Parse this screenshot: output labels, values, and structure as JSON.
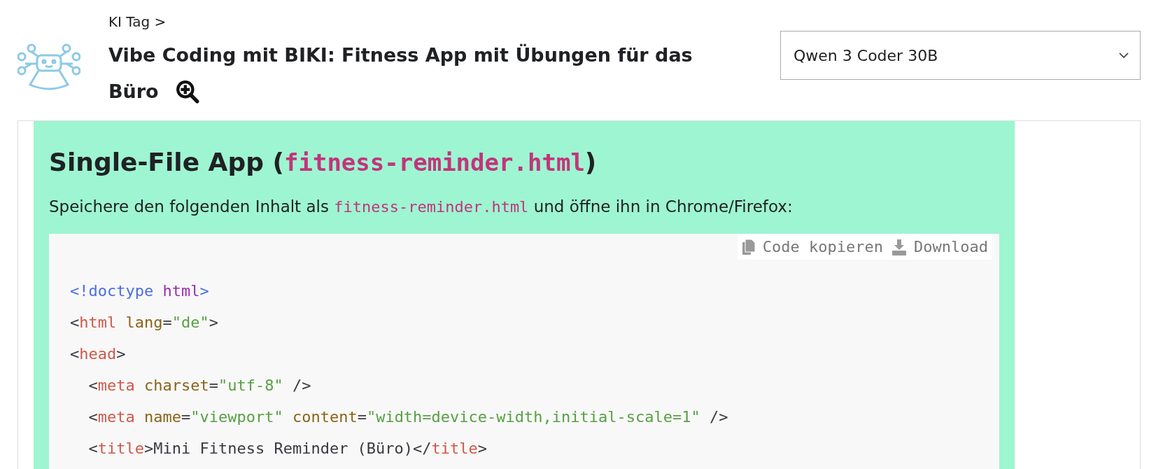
{
  "header": {
    "breadcrumb": "KI Tag >",
    "title_lines": [
      "Vibe Coding mit BIKI: Fitness App mit Übungen für das",
      "Büro"
    ],
    "model_select": {
      "value": "Qwen 3 Coder 30B"
    }
  },
  "content": {
    "heading": [
      {
        "kind": "text",
        "text": "Single-File App ("
      },
      {
        "kind": "code",
        "text": "fitness-reminder.html"
      },
      {
        "kind": "text",
        "text": ")"
      }
    ],
    "paragraph": [
      {
        "kind": "text",
        "text": "Speichere den folgenden Inhalt als "
      },
      {
        "kind": "code",
        "text": "fitness-reminder.html"
      },
      {
        "kind": "text",
        "text": " und öffne ihn in Chrome/Firefox:"
      }
    ],
    "code_block": {
      "actions": [
        {
          "kind": "copy",
          "label": "Code kopieren"
        },
        {
          "kind": "download",
          "label": "Download"
        }
      ],
      "lines": [
        [
          {
            "kind": "doctype",
            "text": "<!doctype "
          },
          {
            "kind": "keyword",
            "text": "html"
          },
          {
            "kind": "doctype",
            "text": ">"
          }
        ],
        [
          {
            "kind": "punct",
            "text": "<"
          },
          {
            "kind": "tag",
            "text": "html"
          },
          {
            "kind": "attr",
            "text": " lang"
          },
          {
            "kind": "punct",
            "text": "="
          },
          {
            "kind": "string",
            "text": "\"de\""
          },
          {
            "kind": "punct",
            "text": ">"
          }
        ],
        [
          {
            "kind": "punct",
            "text": "<"
          },
          {
            "kind": "tag",
            "text": "head"
          },
          {
            "kind": "punct",
            "text": ">"
          }
        ],
        [
          {
            "kind": "punct",
            "text": "  <"
          },
          {
            "kind": "tag",
            "text": "meta"
          },
          {
            "kind": "attr",
            "text": " charset"
          },
          {
            "kind": "punct",
            "text": "="
          },
          {
            "kind": "string",
            "text": "\"utf-8\""
          },
          {
            "kind": "punct",
            "text": " />"
          }
        ],
        [
          {
            "kind": "punct",
            "text": "  <"
          },
          {
            "kind": "tag",
            "text": "meta"
          },
          {
            "kind": "attr",
            "text": " name"
          },
          {
            "kind": "punct",
            "text": "="
          },
          {
            "kind": "string",
            "text": "\"viewport\""
          },
          {
            "kind": "attr",
            "text": " content"
          },
          {
            "kind": "punct",
            "text": "="
          },
          {
            "kind": "string",
            "text": "\"width=device-width,initial-scale=1\""
          },
          {
            "kind": "punct",
            "text": " />"
          }
        ],
        [
          {
            "kind": "punct",
            "text": "  <"
          },
          {
            "kind": "tag",
            "text": "title"
          },
          {
            "kind": "punct",
            "text": ">Mini Fitness Reminder (Büro)</"
          },
          {
            "kind": "tag",
            "text": "title"
          },
          {
            "kind": "punct",
            "text": ">"
          }
        ]
      ]
    }
  }
}
